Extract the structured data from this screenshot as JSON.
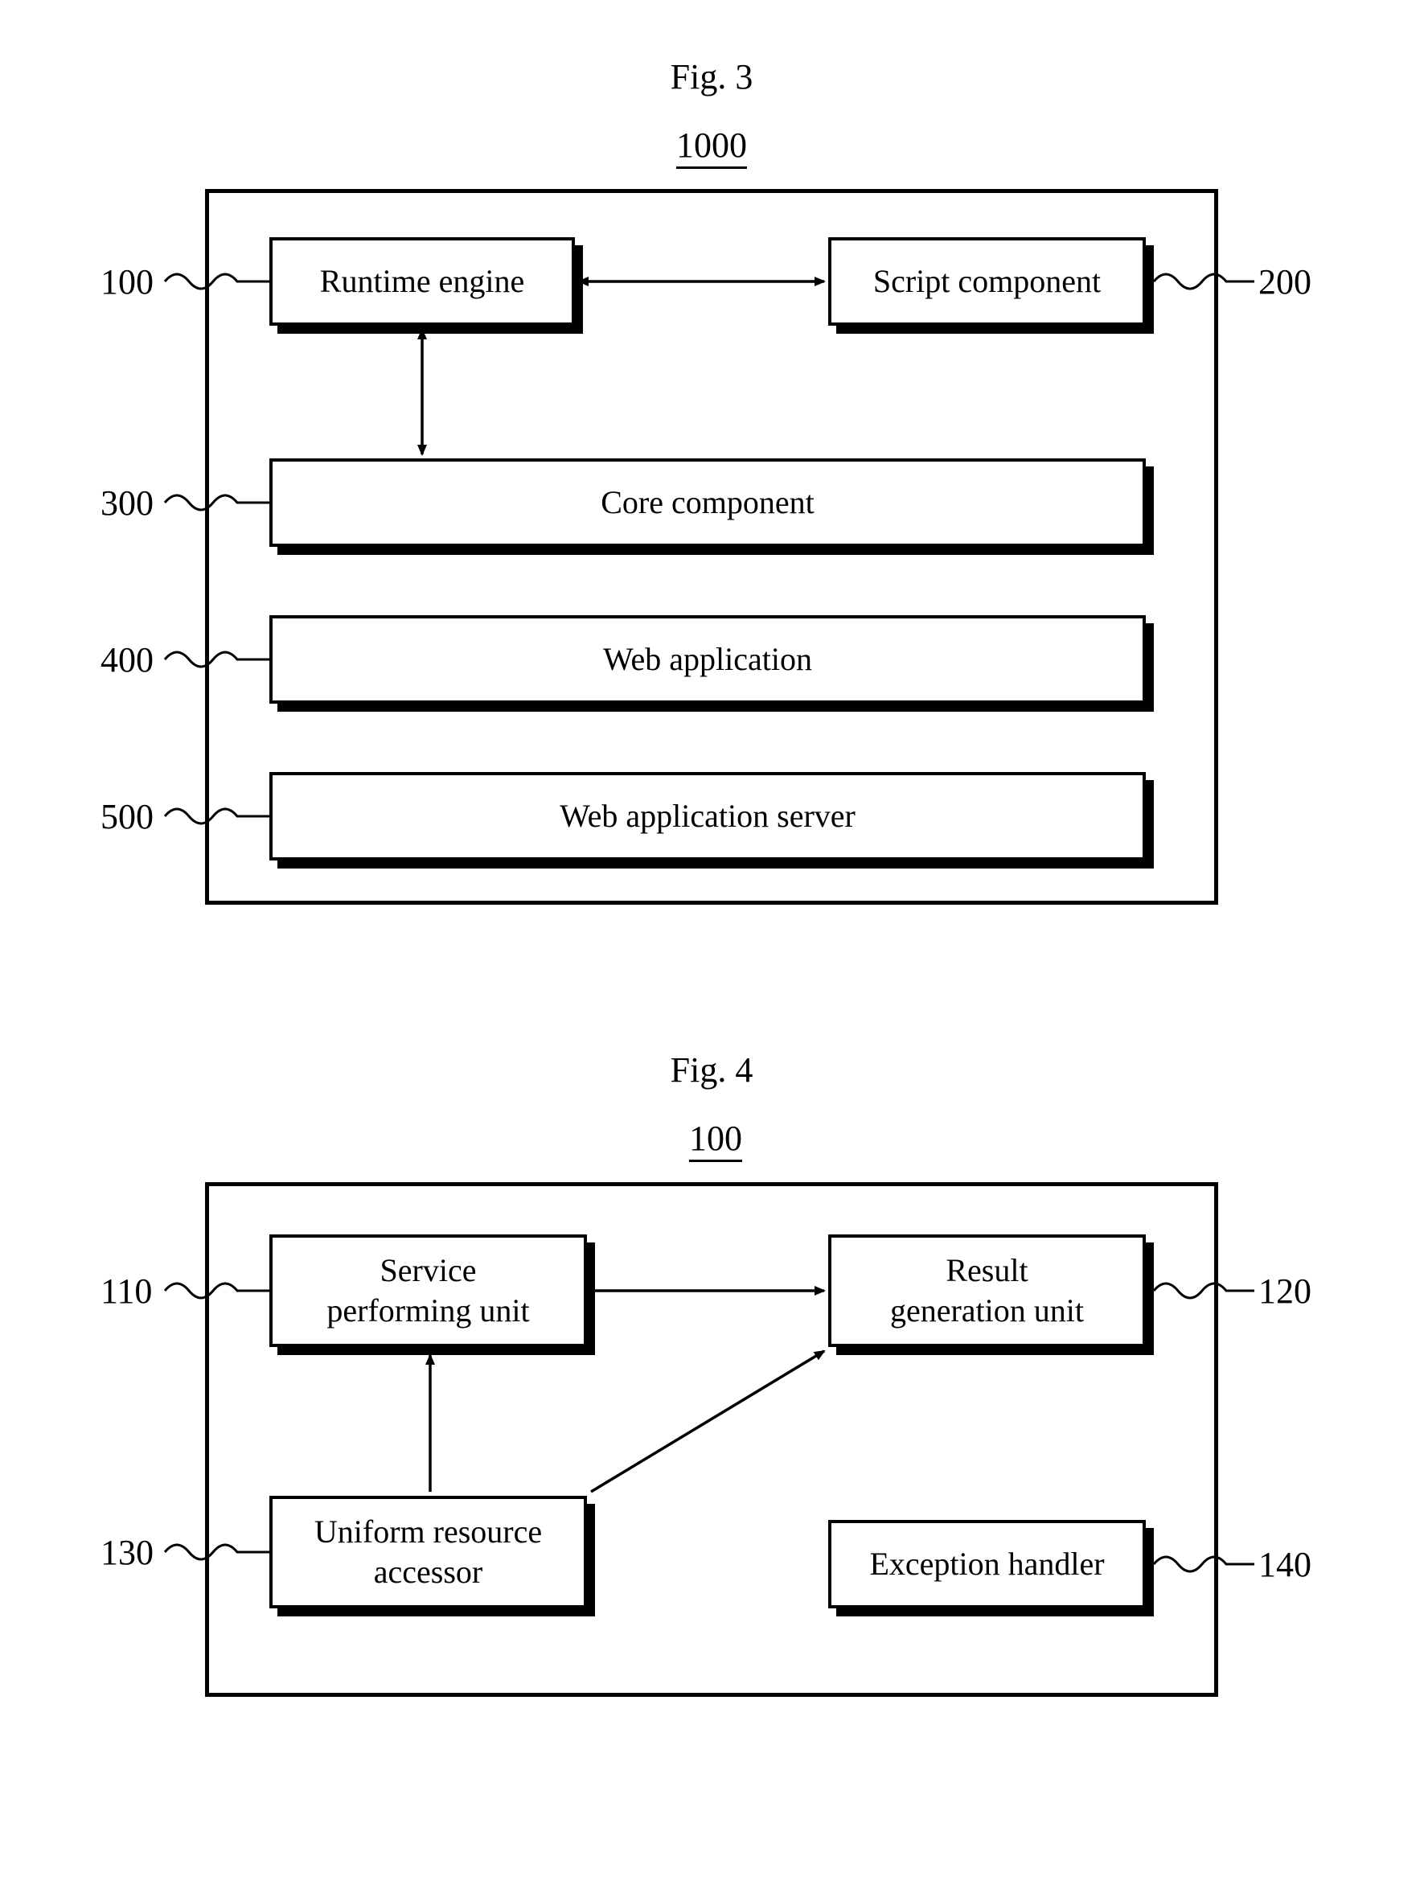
{
  "fig3": {
    "caption": "Fig. 3",
    "number": "1000",
    "refs": {
      "r100": "100",
      "r200": "200",
      "r300": "300",
      "r400": "400",
      "r500": "500"
    },
    "boxes": {
      "runtime": "Runtime engine",
      "script": "Script component",
      "core": "Core component",
      "webapp": "Web application",
      "was": "Web application server"
    }
  },
  "fig4": {
    "caption": "Fig. 4",
    "number": "100",
    "refs": {
      "r110": "110",
      "r120": "120",
      "r130": "130",
      "r140": "140"
    },
    "boxes": {
      "service": "Service\nperforming unit",
      "result": "Result\ngeneration unit",
      "ura": "Uniform resource\naccessor",
      "exc": "Exception handler"
    }
  }
}
